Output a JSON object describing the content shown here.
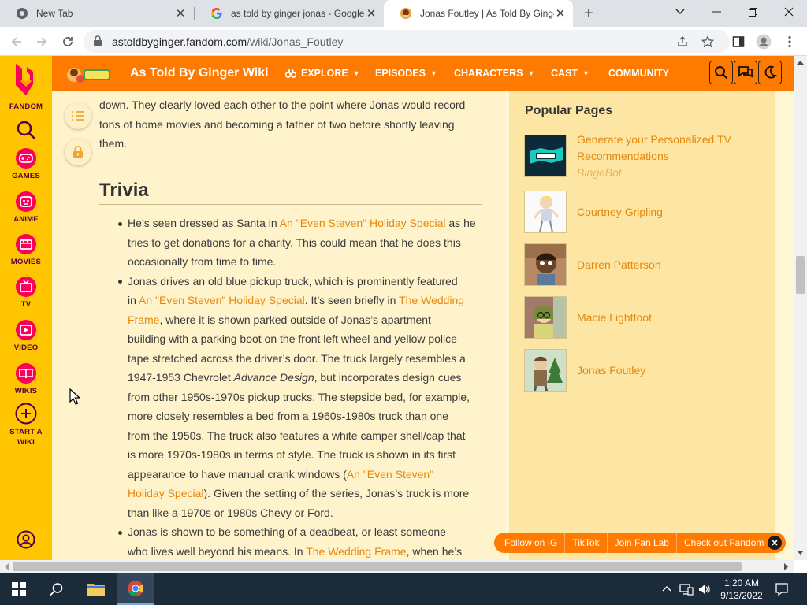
{
  "browser": {
    "tabs": [
      {
        "title": "New Tab"
      },
      {
        "title": "as told by ginger jonas - Google"
      },
      {
        "title": "Jonas Foutley | As Told By Ginger"
      }
    ],
    "url_host": "astoldbyginger.fandom.com",
    "url_path": "/wiki/Jonas_Foutley"
  },
  "rail": {
    "brand": "FANDOM",
    "items": [
      "GAMES",
      "ANIME",
      "MOVIES",
      "TV",
      "VIDEO",
      "WIKIS"
    ],
    "start_a": "START A",
    "start_b": "WIKI"
  },
  "wiki": {
    "name": "As Told By Ginger Wiki",
    "nav": [
      "EXPLORE",
      "EPISODES",
      "CHARACTERS",
      "CAST",
      "COMMUNITY"
    ]
  },
  "article": {
    "intro": [
      "down. They clearly loved each other to the point where Jonas would record",
      "tons of home movies and becoming a father of two before shortly leaving",
      "them."
    ],
    "trivia_heading": "Trivia",
    "b1": {
      "l1a": "He’s seen dressed as Santa in ",
      "l1link": "An \"Even Steven\" Holiday Special",
      "l1b": " as he",
      "l2": "tries to get donations for a charity. This could mean that he does this",
      "l3": "occasionally from time to time."
    },
    "b2": {
      "l1": "Jonas drives an old blue pickup truck, which is prominently featured",
      "l2a": "in ",
      "l2link": "An \"Even Steven\" Holiday Special",
      "l2b": ". It’s seen briefly in ",
      "l2link2": "The Wedding",
      "l3link": "Frame",
      "l3b": ", where it is shown parked outside of Jonas’s apartment",
      "l4": "building with a parking boot on the front left wheel and yellow police",
      "l5": "tape stretched across the driver’s door. The truck largely resembles a",
      "l6a": "1947-1953 Chevrolet ",
      "l6i": "Advance Design",
      "l6b": ", but incorporates design cues",
      "l7": "from other 1950s-1970s pickup trucks. The stepside bed, for example,",
      "l8": "more closely resembles a bed from a 1960s-1980s truck than one",
      "l9": "from the 1950s. The truck also features a white camper shell/cap that",
      "l10": "is more 1970s-1980s in terms of style. The truck is shown in its first",
      "l11a": "appearance to have manual crank windows (",
      "l11link": "An \"Even Steven\"",
      "l12link": "Holiday Special",
      "l12b": "). Given the setting of the series, Jonas’s truck is more",
      "l13": "than like a 1970s or 1980s Chevy or Ford."
    },
    "b3": {
      "l1": "Jonas is shown to be something of a deadbeat, or least someone",
      "l2a": "who lives well beyond his means. In ",
      "l2link": "The Wedding Frame",
      "l2b": ", when he’s"
    }
  },
  "popular": {
    "title": "Popular Pages",
    "items": [
      {
        "l1": "Generate your Personalized TV",
        "l2": "Recommendations",
        "sub": "BingeBot"
      },
      {
        "l1": "Courtney Gripling"
      },
      {
        "l1": "Darren Patterson"
      },
      {
        "l1": "Macie Lightfoot"
      },
      {
        "l1": "Jonas Foutley"
      }
    ]
  },
  "social": [
    "Follow on IG",
    "TikTok",
    "Join Fan Lab",
    "Check out Fandom"
  ],
  "taskbar": {
    "time": "1:20 AM",
    "date": "9/13/2022"
  },
  "colors": {
    "fandom_yellow": "#ffc500",
    "wiki_orange": "#ff7a00",
    "link": "#e5880c"
  }
}
